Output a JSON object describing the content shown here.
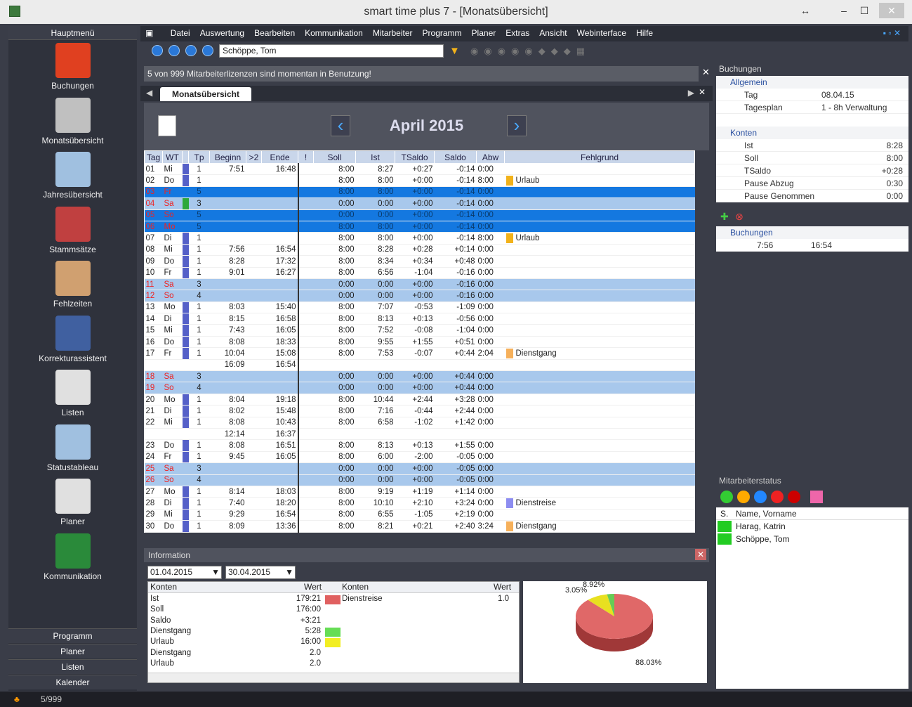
{
  "window": {
    "title": "smart time plus 7 - [Monatsübersicht]",
    "restore_glyph": "↔",
    "min_glyph": "–",
    "max_glyph": "☐",
    "close_glyph": "✕"
  },
  "sidebar": {
    "header": "Hauptmenü",
    "items": [
      {
        "label": "Buchungen",
        "icon": "clock-calendar-icon"
      },
      {
        "label": "Monatsübersicht",
        "icon": "calendar-31-icon"
      },
      {
        "label": "Jahresübersicht",
        "icon": "year-calendar-icon"
      },
      {
        "label": "Stammsätze",
        "icon": "people-icon"
      },
      {
        "label": "Fehlzeiten",
        "icon": "calendar-suitcase-icon"
      },
      {
        "label": "Korrekturassistent",
        "icon": "user-wrench-icon"
      },
      {
        "label": "Listen",
        "icon": "printer-icon"
      },
      {
        "label": "Statustableau",
        "icon": "status-board-icon"
      },
      {
        "label": "Planer",
        "icon": "planner-icon"
      },
      {
        "label": "Kommunikation",
        "icon": "communication-icon"
      }
    ],
    "bottom": [
      "Programm",
      "Planer",
      "Listen",
      "Kalender"
    ]
  },
  "menu": [
    "Datei",
    "Auswertung",
    "Bearbeiten",
    "Kommunikation",
    "Mitarbeiter",
    "Programm",
    "Planer",
    "Extras",
    "Ansicht",
    "Webinterface",
    "Hilfe"
  ],
  "toolbar": {
    "employee": "Schöppe, Tom"
  },
  "infobar": "5 von 999 Mitarbeiterlizenzen sind momentan in Benutzung!",
  "tab": "Monatsübersicht",
  "month": "April 2015",
  "columns": [
    "Tag",
    "WT",
    "Tp",
    "Beginn",
    ">2",
    "Ende",
    "!",
    "Soll",
    "Ist",
    "TSaldo",
    "Saldo",
    "Abw",
    "Fehlgrund"
  ],
  "rows": [
    {
      "d": "01",
      "wt": "Mi",
      "tp": "1",
      "b": "7:51",
      "e": "16:48",
      "soll": "8:00",
      "ist": "8:27",
      "ts": "+0:27",
      "sa": "-0:14",
      "abw": "0:00",
      "fg": "",
      "t": ""
    },
    {
      "d": "02",
      "wt": "Do",
      "tp": "1",
      "b": "",
      "e": "",
      "soll": "8:00",
      "ist": "8:00",
      "ts": "+0:00",
      "sa": "-0:14",
      "abw": "8:00",
      "fg": "Urlaub",
      "c": "#f2b21a",
      "t": ""
    },
    {
      "d": "03",
      "wt": "Fr",
      "tp": "5",
      "b": "",
      "e": "",
      "soll": "8:00",
      "ist": "8:00",
      "ts": "+0:00",
      "sa": "-0:14",
      "abw": "0:00",
      "fg": "",
      "t": "sel"
    },
    {
      "d": "04",
      "wt": "Sa",
      "tp": "3",
      "b": "",
      "e": "",
      "soll": "0:00",
      "ist": "0:00",
      "ts": "+0:00",
      "sa": "-0:14",
      "abw": "0:00",
      "fg": "",
      "t": "we",
      "g": 1
    },
    {
      "d": "05",
      "wt": "So",
      "tp": "5",
      "b": "",
      "e": "",
      "soll": "0:00",
      "ist": "0:00",
      "ts": "+0:00",
      "sa": "-0:14",
      "abw": "0:00",
      "fg": "",
      "t": "sel"
    },
    {
      "d": "06",
      "wt": "Mo",
      "tp": "5",
      "b": "",
      "e": "",
      "soll": "8:00",
      "ist": "8:00",
      "ts": "+0:00",
      "sa": "-0:14",
      "abw": "0:00",
      "fg": "",
      "t": "sel"
    },
    {
      "d": "07",
      "wt": "Di",
      "tp": "1",
      "b": "",
      "e": "",
      "soll": "8:00",
      "ist": "8:00",
      "ts": "+0:00",
      "sa": "-0:14",
      "abw": "8:00",
      "fg": "Urlaub",
      "c": "#f2b21a",
      "t": ""
    },
    {
      "d": "08",
      "wt": "Mi",
      "tp": "1",
      "b": "7:56",
      "e": "16:54",
      "soll": "8:00",
      "ist": "8:28",
      "ts": "+0:28",
      "sa": "+0:14",
      "abw": "0:00",
      "fg": "",
      "t": ""
    },
    {
      "d": "09",
      "wt": "Do",
      "tp": "1",
      "b": "8:28",
      "e": "17:32",
      "soll": "8:00",
      "ist": "8:34",
      "ts": "+0:34",
      "sa": "+0:48",
      "abw": "0:00",
      "fg": "",
      "t": ""
    },
    {
      "d": "10",
      "wt": "Fr",
      "tp": "1",
      "b": "9:01",
      "e": "16:27",
      "soll": "8:00",
      "ist": "6:56",
      "ts": "-1:04",
      "sa": "-0:16",
      "abw": "0:00",
      "fg": "",
      "t": ""
    },
    {
      "d": "11",
      "wt": "Sa",
      "tp": "3",
      "b": "",
      "e": "",
      "soll": "0:00",
      "ist": "0:00",
      "ts": "+0:00",
      "sa": "-0:16",
      "abw": "0:00",
      "fg": "",
      "t": "we"
    },
    {
      "d": "12",
      "wt": "So",
      "tp": "4",
      "b": "",
      "e": "",
      "soll": "0:00",
      "ist": "0:00",
      "ts": "+0:00",
      "sa": "-0:16",
      "abw": "0:00",
      "fg": "",
      "t": "we"
    },
    {
      "d": "13",
      "wt": "Mo",
      "tp": "1",
      "b": "8:03",
      "e": "15:40",
      "soll": "8:00",
      "ist": "7:07",
      "ts": "-0:53",
      "sa": "-1:09",
      "abw": "0:00",
      "fg": "",
      "t": ""
    },
    {
      "d": "14",
      "wt": "Di",
      "tp": "1",
      "b": "8:15",
      "e": "16:58",
      "soll": "8:00",
      "ist": "8:13",
      "ts": "+0:13",
      "sa": "-0:56",
      "abw": "0:00",
      "fg": "",
      "t": ""
    },
    {
      "d": "15",
      "wt": "Mi",
      "tp": "1",
      "b": "7:43",
      "e": "16:05",
      "soll": "8:00",
      "ist": "7:52",
      "ts": "-0:08",
      "sa": "-1:04",
      "abw": "0:00",
      "fg": "",
      "t": ""
    },
    {
      "d": "16",
      "wt": "Do",
      "tp": "1",
      "b": "8:08",
      "e": "18:33",
      "soll": "8:00",
      "ist": "9:55",
      "ts": "+1:55",
      "sa": "+0:51",
      "abw": "0:00",
      "fg": "",
      "t": ""
    },
    {
      "d": "17",
      "wt": "Fr",
      "tp": "1",
      "b": "10:04",
      "e": "15:08",
      "soll": "8:00",
      "ist": "7:53",
      "ts": "-0:07",
      "sa": "+0:44",
      "abw": "2:04",
      "fg": "Dienstgang",
      "c": "#f6b05a",
      "t": ""
    },
    {
      "d": "",
      "wt": "",
      "tp": "",
      "b": "16:09",
      "e": "16:54",
      "soll": "",
      "ist": "",
      "ts": "",
      "sa": "",
      "abw": "",
      "fg": "",
      "t": "",
      "cont": 1
    },
    {
      "d": "18",
      "wt": "Sa",
      "tp": "3",
      "b": "",
      "e": "",
      "soll": "0:00",
      "ist": "0:00",
      "ts": "+0:00",
      "sa": "+0:44",
      "abw": "0:00",
      "fg": "",
      "t": "we"
    },
    {
      "d": "19",
      "wt": "So",
      "tp": "4",
      "b": "",
      "e": "",
      "soll": "0:00",
      "ist": "0:00",
      "ts": "+0:00",
      "sa": "+0:44",
      "abw": "0:00",
      "fg": "",
      "t": "we"
    },
    {
      "d": "20",
      "wt": "Mo",
      "tp": "1",
      "b": "8:04",
      "e": "19:18",
      "soll": "8:00",
      "ist": "10:44",
      "ts": "+2:44",
      "sa": "+3:28",
      "abw": "0:00",
      "fg": "",
      "t": ""
    },
    {
      "d": "21",
      "wt": "Di",
      "tp": "1",
      "b": "8:02",
      "e": "15:48",
      "soll": "8:00",
      "ist": "7:16",
      "ts": "-0:44",
      "sa": "+2:44",
      "abw": "0:00",
      "fg": "",
      "t": ""
    },
    {
      "d": "22",
      "wt": "Mi",
      "tp": "1",
      "b": "8:08",
      "e": "10:43",
      "soll": "8:00",
      "ist": "6:58",
      "ts": "-1:02",
      "sa": "+1:42",
      "abw": "0:00",
      "fg": "",
      "t": ""
    },
    {
      "d": "",
      "wt": "",
      "tp": "",
      "b": "12:14",
      "e": "16:37",
      "soll": "",
      "ist": "",
      "ts": "",
      "sa": "",
      "abw": "",
      "fg": "",
      "t": "",
      "cont": 1
    },
    {
      "d": "23",
      "wt": "Do",
      "tp": "1",
      "b": "8:08",
      "e": "16:51",
      "soll": "8:00",
      "ist": "8:13",
      "ts": "+0:13",
      "sa": "+1:55",
      "abw": "0:00",
      "fg": "",
      "t": ""
    },
    {
      "d": "24",
      "wt": "Fr",
      "tp": "1",
      "b": "9:45",
      "e": "16:05",
      "soll": "8:00",
      "ist": "6:00",
      "ts": "-2:00",
      "sa": "-0:05",
      "abw": "0:00",
      "fg": "",
      "t": ""
    },
    {
      "d": "25",
      "wt": "Sa",
      "tp": "3",
      "b": "",
      "e": "",
      "soll": "0:00",
      "ist": "0:00",
      "ts": "+0:00",
      "sa": "-0:05",
      "abw": "0:00",
      "fg": "",
      "t": "we"
    },
    {
      "d": "26",
      "wt": "So",
      "tp": "4",
      "b": "",
      "e": "",
      "soll": "0:00",
      "ist": "0:00",
      "ts": "+0:00",
      "sa": "-0:05",
      "abw": "0:00",
      "fg": "",
      "t": "we"
    },
    {
      "d": "27",
      "wt": "Mo",
      "tp": "1",
      "b": "8:14",
      "e": "18:03",
      "soll": "8:00",
      "ist": "9:19",
      "ts": "+1:19",
      "sa": "+1:14",
      "abw": "0:00",
      "fg": "",
      "t": ""
    },
    {
      "d": "28",
      "wt": "Di",
      "tp": "1",
      "b": "7:40",
      "e": "18:20",
      "soll": "8:00",
      "ist": "10:10",
      "ts": "+2:10",
      "sa": "+3:24",
      "abw": "0:00",
      "fg": "Dienstreise",
      "c": "#8c8cf0",
      "t": ""
    },
    {
      "d": "29",
      "wt": "Mi",
      "tp": "1",
      "b": "9:29",
      "e": "16:54",
      "soll": "8:00",
      "ist": "6:55",
      "ts": "-1:05",
      "sa": "+2:19",
      "abw": "0:00",
      "fg": "",
      "t": ""
    },
    {
      "d": "30",
      "wt": "Do",
      "tp": "1",
      "b": "8:09",
      "e": "13:36",
      "soll": "8:00",
      "ist": "8:21",
      "ts": "+0:21",
      "sa": "+2:40",
      "abw": "3:24",
      "fg": "Dienstgang",
      "c": "#f6b05a",
      "t": ""
    }
  ],
  "info": {
    "title": "Information",
    "from": "01.04.2015",
    "to": "30.04.2015",
    "head1": "Konten",
    "head2": "Wert",
    "head3": "Konten",
    "head4": "Wert",
    "left": [
      {
        "k": "Ist",
        "w": "179:21",
        "c": "#e06060"
      },
      {
        "k": "Soll",
        "w": "176:00"
      },
      {
        "k": "Saldo",
        "w": "+3:21"
      },
      {
        "k": "Dienstgang",
        "w": "5:28",
        "c": "#66dd55"
      },
      {
        "k": "Urlaub",
        "w": "16:00",
        "c": "#f2ee22"
      },
      {
        "k": "Dienstgang",
        "w": "2.0"
      },
      {
        "k": "Urlaub",
        "w": "2.0"
      }
    ],
    "right": [
      {
        "k": "Dienstreise",
        "w": "1.0"
      }
    ],
    "pie_labels": [
      "3.05%",
      "8.92%",
      "88.03%"
    ]
  },
  "chart_data": {
    "type": "pie",
    "slices": [
      {
        "label": "Ist",
        "value": 88.03,
        "color": "#e06868"
      },
      {
        "label": "Urlaub",
        "value": 8.92,
        "color": "#e8e020"
      },
      {
        "label": "Dienstgang",
        "value": 3.05,
        "color": "#66cc55"
      }
    ]
  },
  "buchungen": {
    "title": "Buchungen",
    "sec1": "Allgemein",
    "tag_l": "Tag",
    "tag_v": "08.04.15",
    "tp_l": "Tagesplan",
    "tp_v": "1 - 8h Verwaltung",
    "sec2": "Konten",
    "konten": [
      {
        "l": "Ist",
        "v": "8:28"
      },
      {
        "l": "Soll",
        "v": "8:00"
      },
      {
        "l": "TSaldo",
        "v": "+0:28"
      },
      {
        "l": "Pause Abzug",
        "v": "0:30"
      },
      {
        "l": "Pause Genommen",
        "v": "0:00"
      }
    ],
    "sec3": "Buchungen",
    "b_from": "7:56",
    "b_to": "16:54"
  },
  "mstatus": {
    "title": "Mitarbeiterstatus",
    "col1": "S.",
    "col2": "Name, Vorname",
    "names": [
      "Harag, Katrin",
      "Schöppe, Tom"
    ]
  },
  "statusbar": "5/999"
}
